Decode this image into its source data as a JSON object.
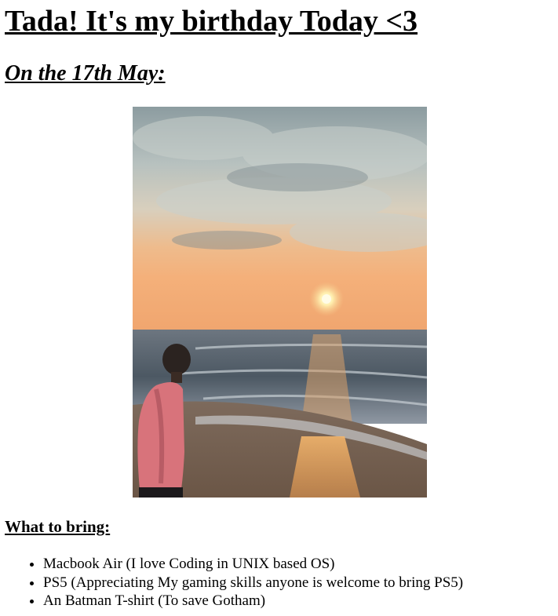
{
  "header": {
    "title": "Tada! It's my birthday Today <3",
    "date_line": "On the 17th May:"
  },
  "photo": {
    "subject": "person-standing-on-beach-at-sunset-photo",
    "colors": {
      "sky_top": "#8f9ea2",
      "sky_horizon": "#f3b37d",
      "sun": "#fff6c8",
      "sea": "#4e5a66",
      "sand": "#8b6e57",
      "shirt": "#d9707a"
    }
  },
  "bring": {
    "heading": "What to bring:",
    "items": [
      "Macbook Air (I love Coding in UNIX based OS)",
      "PS5 (Appreciating My gaming skills anyone is welcome to bring PS5)",
      "An Batman T-shirt (To save Gotham)"
    ]
  }
}
